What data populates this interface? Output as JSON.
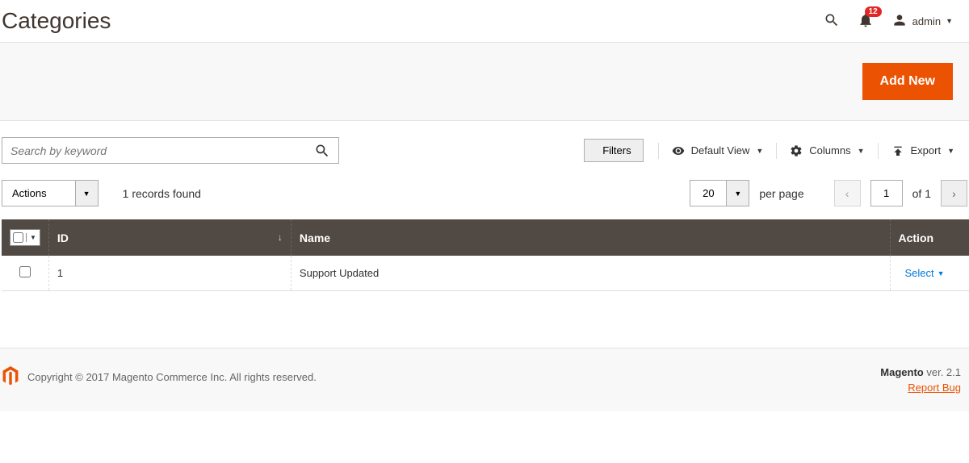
{
  "header": {
    "title": "Categories",
    "notifications": "12",
    "user": "admin"
  },
  "actionBar": {
    "addNewLabel": "Add New"
  },
  "toolbar": {
    "searchPlaceholder": "Search by keyword",
    "filters": "Filters",
    "defaultView": "Default View",
    "columns": "Columns",
    "export": "Export"
  },
  "grid": {
    "actionsLabel": "Actions",
    "recordsFound": "1 records found",
    "pageSize": "20",
    "perPage": "per page",
    "currentPage": "1",
    "ofText": "of 1",
    "columns": {
      "id": "ID",
      "name": "Name",
      "action": "Action"
    },
    "rows": [
      {
        "id": "1",
        "name": "Support Updated",
        "action": "Select"
      }
    ]
  },
  "footer": {
    "copyright": "Copyright © 2017 Magento Commerce Inc. All rights reserved.",
    "brand": "Magento",
    "version": " ver. 2.1",
    "reportBugs": "Report Bug"
  }
}
